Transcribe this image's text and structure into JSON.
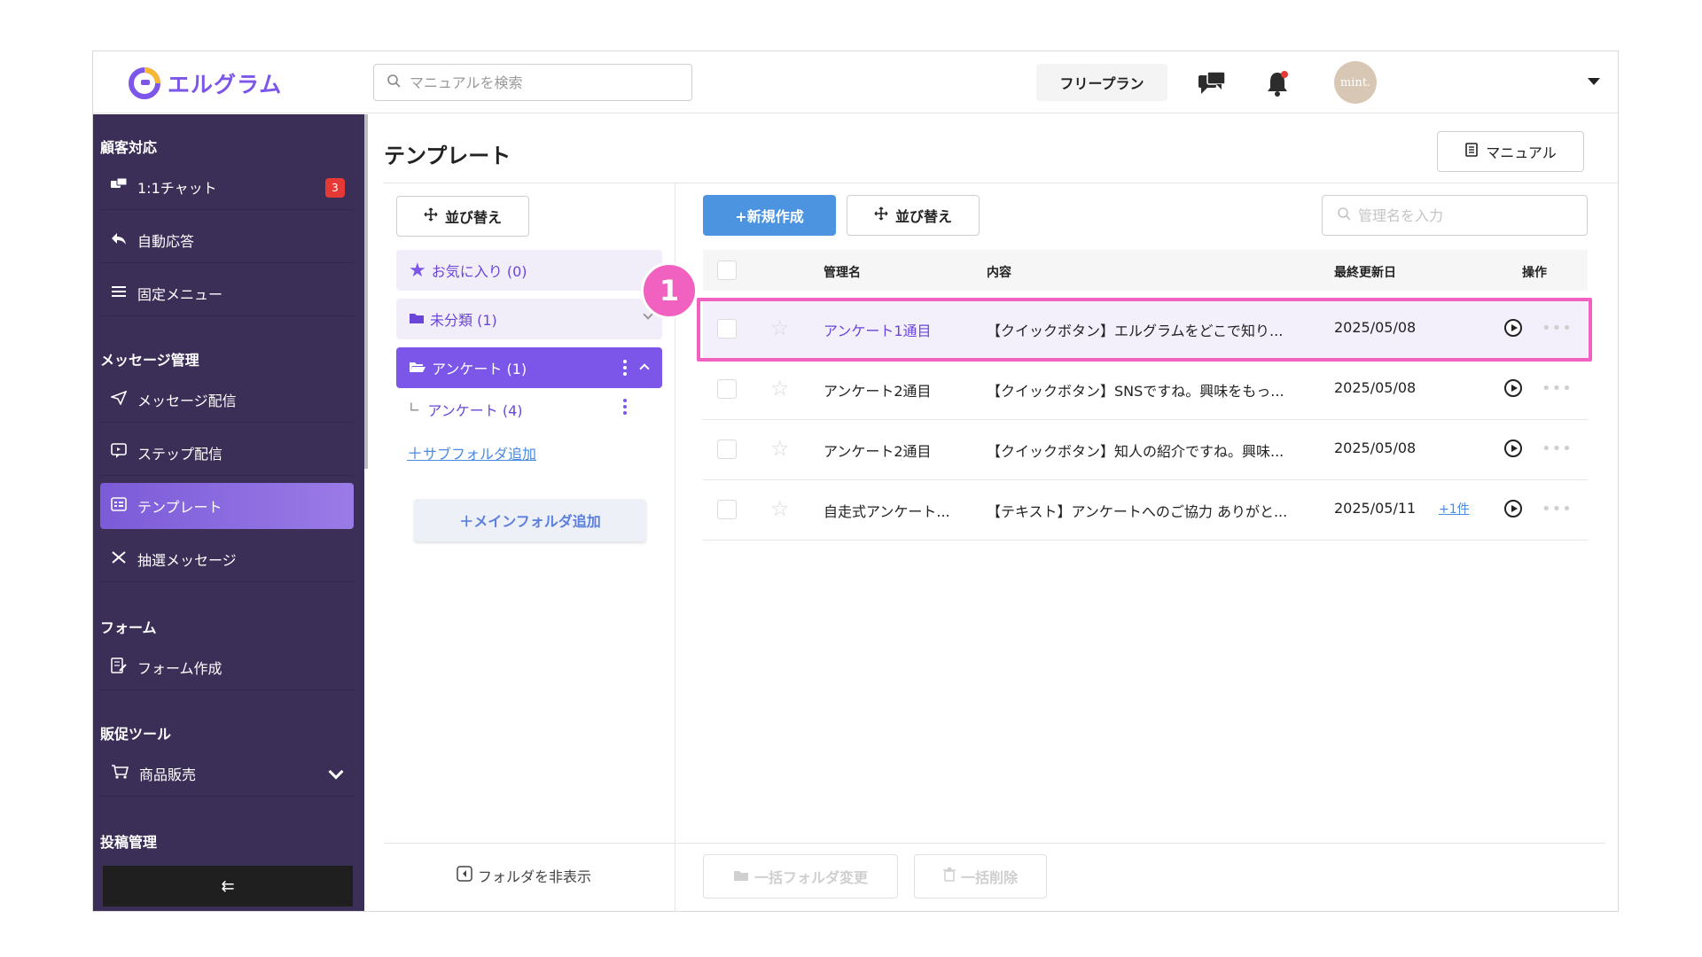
{
  "header": {
    "brand": "エルグラム",
    "search_placeholder": "マニュアルを検索",
    "plan": "フリープラン",
    "avatar": "mint."
  },
  "sidebar": {
    "sections": {
      "customer": "顧客対応",
      "message": "メッセージ管理",
      "form": "フォーム",
      "promo": "販促ツール",
      "post": "投稿管理"
    },
    "items": {
      "chat": "1:1チャット",
      "chat_badge": "3",
      "auto_reply": "自動応答",
      "fixed_menu": "固定メニュー",
      "message_delivery": "メッセージ配信",
      "step_delivery": "ステップ配信",
      "template": "テンプレート",
      "lottery": "抽選メッセージ",
      "form_create": "フォーム作成",
      "product_sales": "商品販売"
    },
    "collapse_label": "⇇"
  },
  "page": {
    "title": "テンプレート",
    "manual_button": "マニュアル"
  },
  "folders": {
    "sort_button": "並び替え",
    "favorites": "お気に入り (0)",
    "uncategorized": "未分類 (1)",
    "survey": "アンケート (1)",
    "sub_survey": "アンケート (4)",
    "add_subfolder": "サブフォルダ追加",
    "add_main_folder": "＋メインフォルダ追加",
    "hide_folders": "フォルダを非表示"
  },
  "toolbar": {
    "new_button": "+新規作成",
    "sort_button": "並び替え",
    "filter_placeholder": "管理名を入力"
  },
  "table": {
    "headers": {
      "name": "管理名",
      "content": "内容",
      "updated": "最終更新日",
      "actions": "操作"
    },
    "rows": [
      {
        "name": "アンケート1通目",
        "content": "【クイックボタン】エルグラムをどこで知り...",
        "date": "2025/05/08",
        "extra": ""
      },
      {
        "name": "アンケート2通目",
        "content": "【クイックボタン】SNSですね。興味をもっ...",
        "date": "2025/05/08",
        "extra": ""
      },
      {
        "name": "アンケート2通目",
        "content": "【クイックボタン】知人の紹介ですね。興味...",
        "date": "2025/05/08",
        "extra": ""
      },
      {
        "name": "自走式アンケート...",
        "content": "【テキスト】アンケートへのご協力 ありがと...",
        "date": "2025/05/11",
        "extra": "+1件"
      }
    ]
  },
  "footer": {
    "bulk_folder_change": "一括フォルダ変更",
    "bulk_delete": "一括削除"
  },
  "annotation": {
    "step": "1"
  },
  "colors": {
    "brand": "#7b56e8",
    "sidebar_bg": "#3b2e57",
    "primary_button": "#4c94e0",
    "highlight": "#f061c0",
    "badge": "#e53935"
  }
}
